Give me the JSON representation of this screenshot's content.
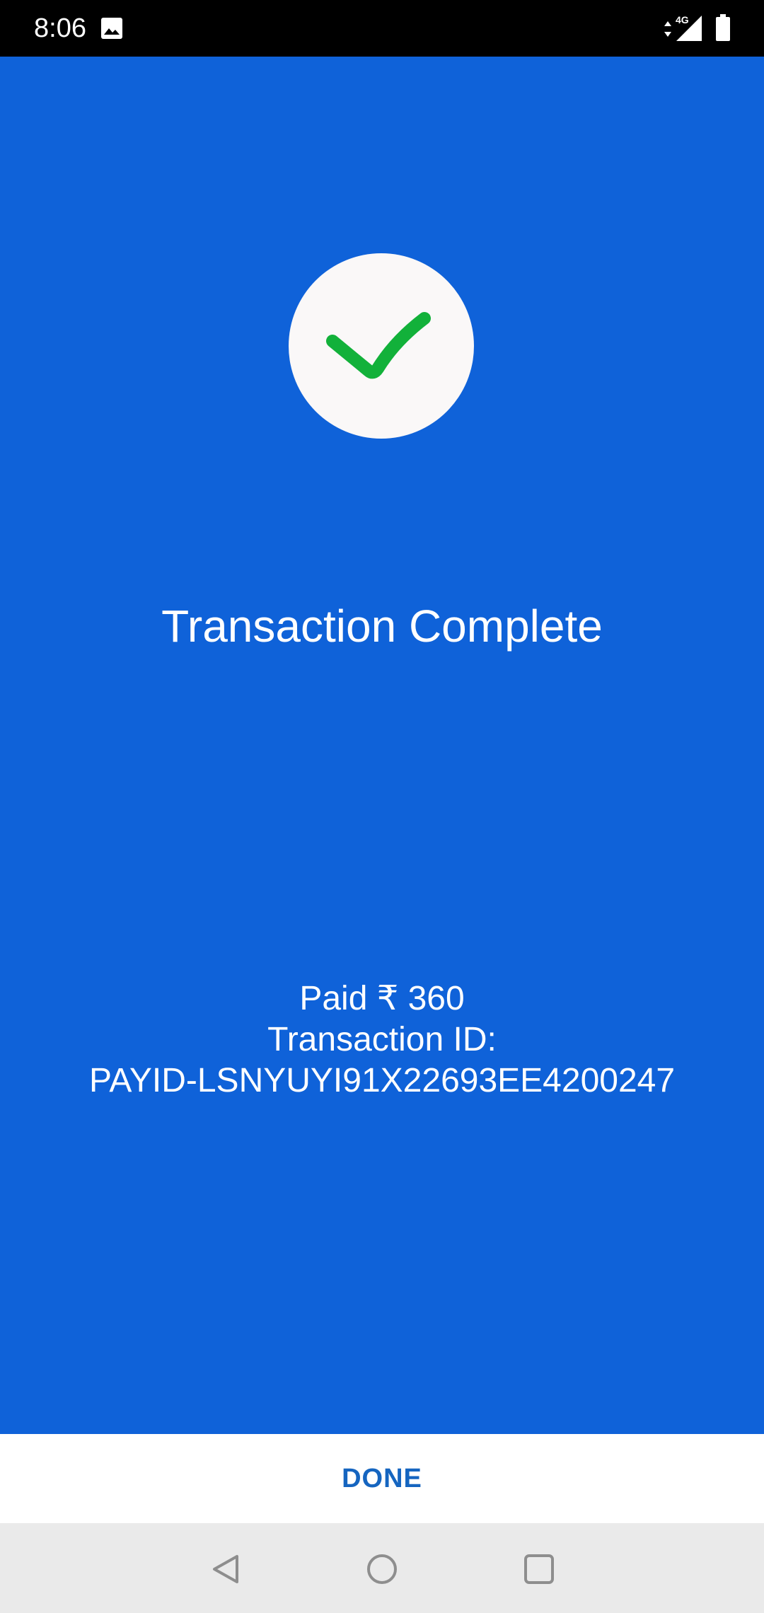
{
  "status_bar": {
    "time": "8:06",
    "network_type": "4G",
    "icons": [
      "gallery-icon",
      "data-arrows-icon",
      "signal-icon",
      "battery-icon"
    ]
  },
  "main": {
    "title": "Transaction Complete",
    "amount_line": "Paid ₹ 360",
    "transaction_id_label": "Transaction ID:",
    "transaction_id_value": "PAYID-LSNYUYI91X22693EE4200247"
  },
  "footer": {
    "done_label": "DONE"
  },
  "nav_bar": {
    "icons": [
      "back-icon",
      "home-icon",
      "recents-icon"
    ]
  },
  "colors": {
    "background": "#0F62D9",
    "check": "#12B13A",
    "circle": "#FAF8F8",
    "done_text": "#1565C0",
    "nav_bar": "#EAEAEA"
  }
}
